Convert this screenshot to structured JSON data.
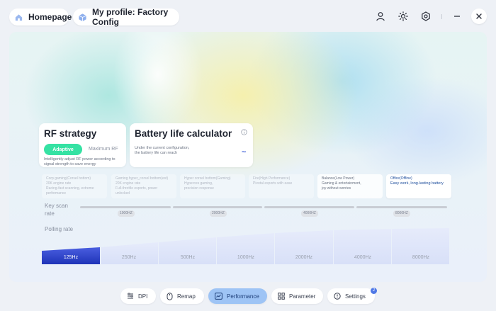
{
  "header": {
    "home_label": "Homepage",
    "profile_label": "My profile: Factory Config"
  },
  "rf_strategy": {
    "title": "RF strategy",
    "options": [
      "Adaptive",
      "Maximum RF"
    ],
    "selected": "Adaptive",
    "description_line1": "Intelligently adjust RF power according to",
    "description_line2": "signal strength to save energy"
  },
  "battery": {
    "title": "Battery life calculator",
    "description_line1": "Under the current configuration,",
    "description_line2": "the battery life can reach",
    "value": "~"
  },
  "modes": [
    {
      "name": "Corp gaming(Corsel bottom)",
      "line1": "20K engine rate",
      "line2": "Racing-fast scanning, extreme",
      "line3": "performance"
    },
    {
      "name": "Gaming hyper_corsel bottom(est)",
      "line1": "20K engine rate",
      "line2": "Full-throttle esports, power",
      "line3": "unlocked"
    },
    {
      "name": "Hyper corsel bottom(Gaming)",
      "line1": "Hyperces gaming,",
      "line2": "precision response",
      "line3": ""
    },
    {
      "name": "Fire(High Performance)",
      "line1": "Pivotal esports with ease",
      "line2": "",
      "line3": ""
    },
    {
      "name": "Balance(Low Power)",
      "line1": "Gaming & entertainment,",
      "line2": "joy without worries",
      "line3": ""
    },
    {
      "name": "Office(Offline)",
      "line1": "Easy work, long-lasting battery",
      "line2": "",
      "line3": ""
    }
  ],
  "key_scan": {
    "label_line1": "Key scan",
    "label_line2": "rate",
    "ticks": [
      "1000HZ",
      "2000HZ",
      "4000HZ",
      "8000HZ"
    ]
  },
  "polling": {
    "label": "Polling rate",
    "options": [
      "125Hz",
      "250Hz",
      "500Hz",
      "1000Hz",
      "2000Hz",
      "4000Hz",
      "8000Hz"
    ],
    "selected": "125Hz"
  },
  "nav": {
    "dpi": "DPI",
    "remap": "Remap",
    "performance": "Performance",
    "parameter": "Parameter",
    "settings": "Settings",
    "settings_badge": "2",
    "active": "Performance"
  },
  "colors": {
    "accent_green": "#35e2a3",
    "accent_blue": "#9ec4f5",
    "polling_selected": "#2a3fc7",
    "polling_bar": "#dfe6fb"
  },
  "icons": {
    "home": "home-icon",
    "profile": "cube-icon",
    "user": "user-icon",
    "light": "sun-icon",
    "settings": "hexagon-gear-icon",
    "minimize": "minus-icon",
    "close": "close-icon",
    "info": "info-icon"
  }
}
